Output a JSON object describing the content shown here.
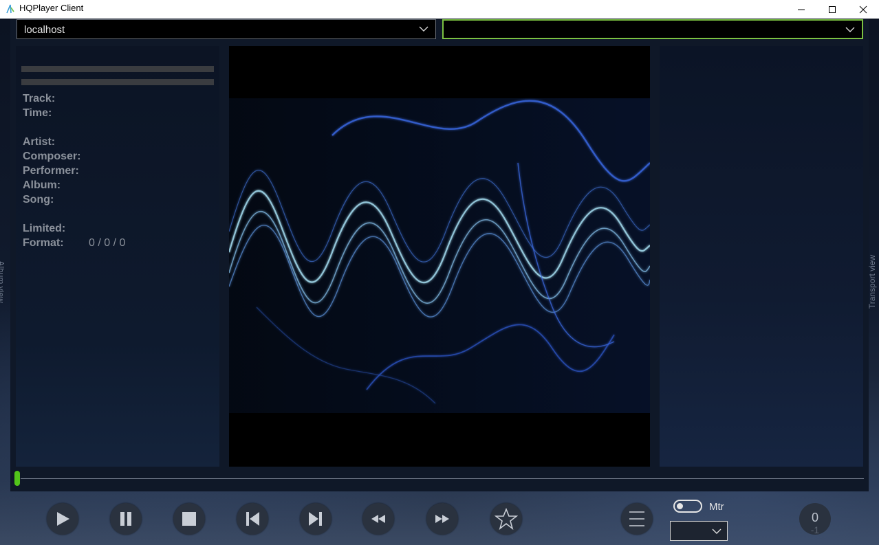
{
  "window": {
    "title": "HQPlayer Client"
  },
  "connection": {
    "host": "localhost",
    "player": ""
  },
  "side_labels": {
    "left": "Album view",
    "right": "Transport view"
  },
  "info": {
    "track_label": "Track:",
    "track_value": "",
    "time_label": "Time:",
    "time_value": "",
    "artist_label": "Artist:",
    "artist_value": "",
    "composer_label": "Composer:",
    "composer_value": "",
    "performer_label": "Performer:",
    "performer_value": "",
    "album_label": "Album:",
    "album_value": "",
    "song_label": "Song:",
    "song_value": "",
    "limited_label": "Limited:",
    "limited_value": "",
    "format_label": "Format:",
    "format_value": "0 / 0 / 0"
  },
  "seek": {
    "position": 0
  },
  "controls": {
    "meter_label": "Mtr",
    "meter_enabled": false,
    "mode_value": "",
    "counter_top": "0",
    "counter_bottom": "-1"
  },
  "colors": {
    "accent": "#7bc142",
    "seek": "#52c41a",
    "button": "#2a323f"
  }
}
